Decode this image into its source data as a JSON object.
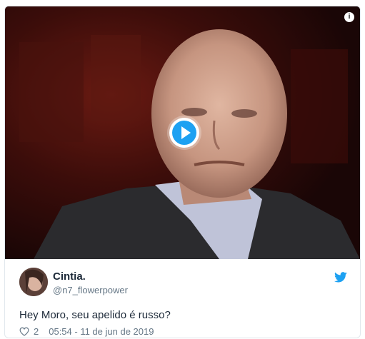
{
  "tweet": {
    "author_name": "Cintia.",
    "author_handle": "@n7_flowerpower",
    "text": "Hey Moro, seu apelido é russo?",
    "likes": "2",
    "timestamp": "05:54 - 11 de jun de 2019"
  },
  "media": {
    "info_glyph": "i"
  },
  "colors": {
    "accent": "#1da1f2",
    "secondary_text": "#657786",
    "heart": "#657786"
  }
}
